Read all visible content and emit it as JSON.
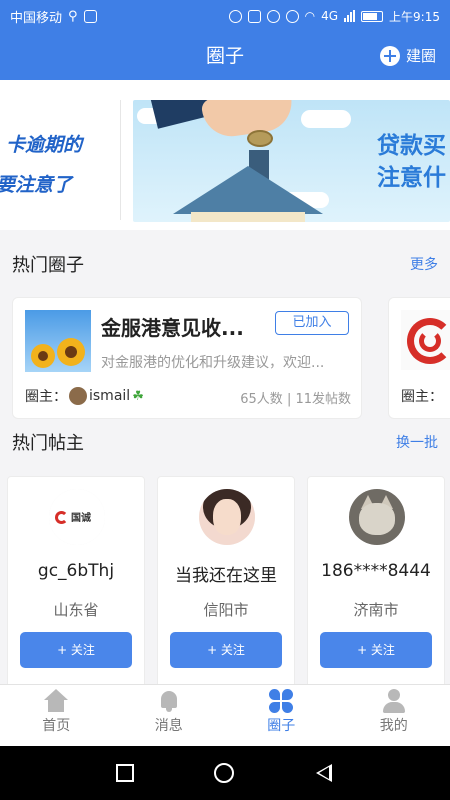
{
  "status_bar": {
    "carrier": "中国移动",
    "time": "上午9:15",
    "network": "4G"
  },
  "header": {
    "title": "圈子",
    "create_label": "建圈"
  },
  "banner": {
    "prev_slide_lines": [
      "卡逾期的",
      "要注意了"
    ],
    "main_slide_lines": [
      "贷款买",
      "注意什"
    ]
  },
  "hot_circles": {
    "title": "热门圈子",
    "more_label": "更多",
    "items": [
      {
        "name": "金服港意见收...",
        "desc": "对金服港的优化和升级建议，欢迎...",
        "joined_label": "已加入",
        "owner_label": "圈主：",
        "owner_name": "ismail",
        "owner_badge": "☘",
        "stats": "65人数 | 11发帖数"
      },
      {
        "owner_label": "圈主："
      }
    ]
  },
  "hot_posters": {
    "title": "热门帖主",
    "refresh_label": "换一批",
    "items": [
      {
        "name": "gc_6bThj",
        "region": "山东省",
        "follow_label": "+ 关注",
        "logo_text": "国诚"
      },
      {
        "name": "当我还在这里",
        "region": "信阳市",
        "follow_label": "+ 关注"
      },
      {
        "name": "186****8444",
        "region": "济南市",
        "follow_label": "+ 关注"
      }
    ]
  },
  "tabs": [
    {
      "label": "首页",
      "icon": "home-icon",
      "active": false
    },
    {
      "label": "消息",
      "icon": "bell-icon",
      "active": false
    },
    {
      "label": "圈子",
      "icon": "circle-icon",
      "active": true
    },
    {
      "label": "我的",
      "icon": "user-icon",
      "active": false
    }
  ],
  "colors": {
    "brand": "#3f7fe6",
    "follow_button": "#4a86ea",
    "muted_text": "#999999"
  }
}
